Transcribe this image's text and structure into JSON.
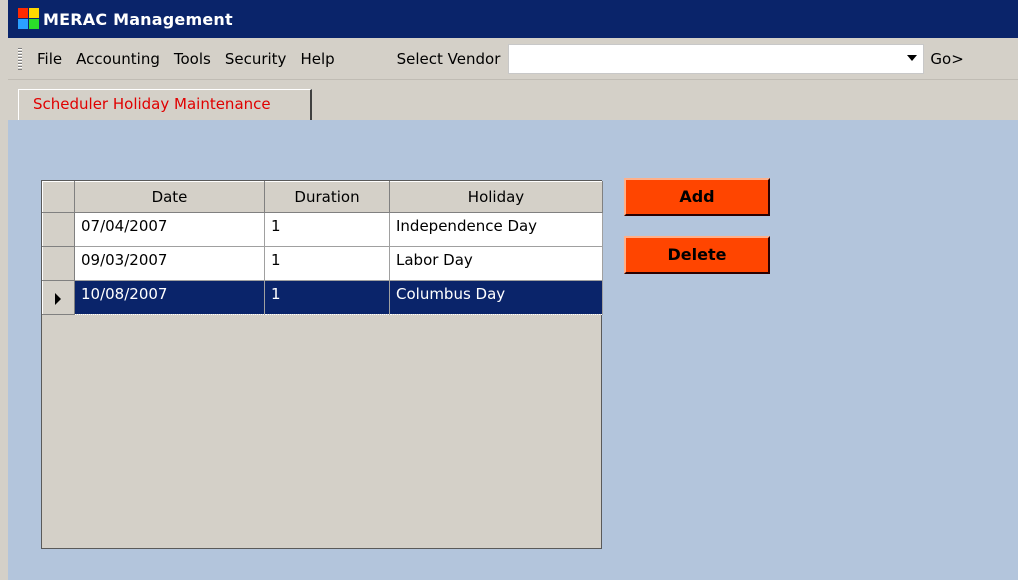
{
  "window": {
    "title": "MERAC Management"
  },
  "menu": {
    "items": [
      "File",
      "Accounting",
      "Tools",
      "Security",
      "Help"
    ],
    "vendor_label": "Select Vendor",
    "vendor_value": "",
    "go_label": "Go>"
  },
  "tabs": [
    {
      "label": "Scheduler Holiday Maintenance",
      "active": true
    }
  ],
  "grid": {
    "columns": [
      "Date",
      "Duration",
      "Holiday"
    ],
    "rows": [
      {
        "date": "07/04/2007",
        "duration": "1",
        "holiday": "Independence Day",
        "selected": false
      },
      {
        "date": "09/03/2007",
        "duration": "1",
        "holiday": "Labor Day",
        "selected": false
      },
      {
        "date": "10/08/2007",
        "duration": "1",
        "holiday": "Columbus Day",
        "selected": true
      }
    ]
  },
  "buttons": {
    "add": "Add",
    "delete": "Delete"
  },
  "colors": {
    "titlebar": "#0a246a",
    "workspace": "#b3c5dc",
    "button": "#ff4500",
    "tab_text": "#e00000",
    "selection": "#0a246a"
  }
}
